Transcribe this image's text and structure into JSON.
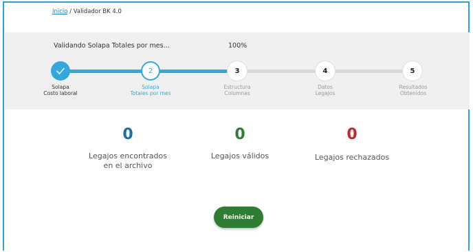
{
  "breadcrumb": {
    "home": "Inicio",
    "separator": "/",
    "current": "Validador BK 4.0"
  },
  "progress": {
    "status": "Validando Solapa Totales por mes...",
    "percent": "100%"
  },
  "steps": [
    {
      "number": "1",
      "label_line1": "Solapa",
      "label_line2": "Costo laboral",
      "state": "completed"
    },
    {
      "number": "2",
      "label_line1": "Solapa",
      "label_line2": "Totales por mes",
      "state": "active"
    },
    {
      "number": "3",
      "label_line1": "Estructura",
      "label_line2": "Columnas",
      "state": "pending"
    },
    {
      "number": "4",
      "label_line1": "Datos",
      "label_line2": "Legajos",
      "state": "pending"
    },
    {
      "number": "5",
      "label_line1": "Resultados",
      "label_line2": "Obtenidos",
      "state": "pending"
    }
  ],
  "stats": [
    {
      "value": "0",
      "label_line1": "Legajos encontrados",
      "label_line2": "en el archivo",
      "color": "#1a6ea8"
    },
    {
      "value": "0",
      "label_line1": "Legajos válidos",
      "label_line2": "",
      "color": "#2e7d32"
    },
    {
      "value": "0",
      "label_line1": "Legajos rechazados",
      "label_line2": "",
      "color": "#c62828"
    }
  ],
  "actions": {
    "restart": "Reiniciar"
  },
  "colors": {
    "accent": "#31a9de",
    "success": "#2e7d32",
    "danger": "#c62828"
  }
}
